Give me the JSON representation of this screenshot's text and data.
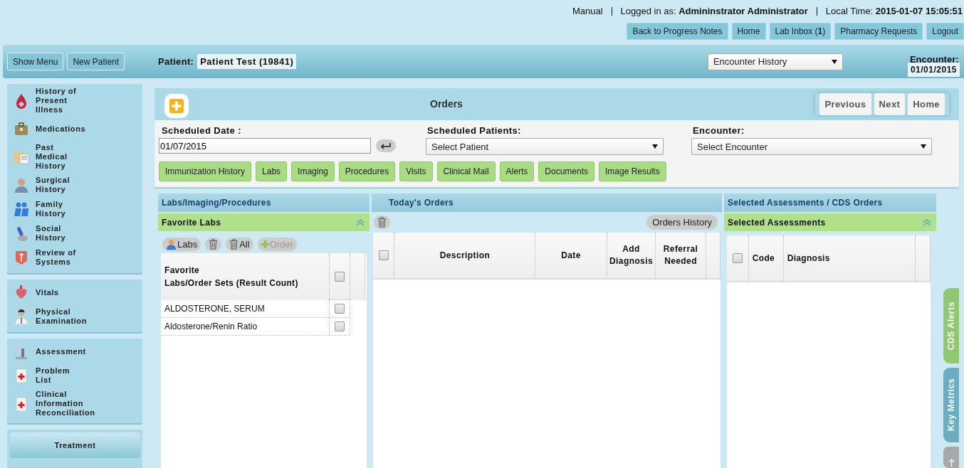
{
  "top": {
    "mode": "Manual",
    "logged_in_label": "Logged in as:",
    "user": "Admininstrator Administrator",
    "time_label": "Local Time:",
    "time": "2015-01-07 15:05:51"
  },
  "top_buttons": [
    "Back to Progress Notes",
    "Home",
    "Lab Inbox (**1**)",
    "Pharmacy Requests",
    "Logout"
  ],
  "toolbar": {
    "buttons": [
      "Show Menu",
      "New Patient"
    ],
    "patient_label": "Patient:",
    "patient": "Patient Test (19841)",
    "history_select": "Encounter History",
    "encounter_label": "Encounter:",
    "encounter": "01/01/2015"
  },
  "sidebar": {
    "groups": [
      {
        "items": [
          "History of\nPresent\nIllness",
          "Medications",
          "Past\nMedical\nHistory",
          "Surgical\nHistory",
          "Family\nHistory",
          "Social\nHistory",
          "Review of\nSystems"
        ]
      },
      {
        "items": [
          "Vitals",
          "Physical\nExamination"
        ]
      },
      {
        "items": [
          "Assessment",
          "Problem\nList",
          "Clinical\nInformation\nReconciliation"
        ]
      }
    ],
    "treatment": "Treatment"
  },
  "orders": {
    "title": "Orders",
    "nav": [
      "Previous",
      "Next",
      "Home"
    ],
    "fields": [
      {
        "label": "Scheduled Date :",
        "value": "01/07/2015",
        "kind": "date"
      },
      {
        "label": "Scheduled Patients:",
        "value": "Select Patient",
        "kind": "select"
      },
      {
        "label": "Encounter:",
        "value": "Select Encounter",
        "kind": "select"
      }
    ],
    "categories": [
      "Immunization History",
      "Labs",
      "Imaging",
      "Procedures",
      "Visits",
      "Clinical Mail",
      "Alerts",
      "Documents",
      "Image Results"
    ]
  },
  "labs_panel": {
    "title": "Labs/Imaging/Procedures",
    "section": "Favorite Labs",
    "tools": [
      {
        "kind": "labs",
        "label": "Labs",
        "disabled": false
      },
      {
        "kind": "delete",
        "disabled": false
      },
      {
        "kind": "delete-all",
        "label": "All",
        "disabled": false
      },
      {
        "kind": "order",
        "label": "Order",
        "disabled": true
      }
    ],
    "header": "Favorite\nLabs/Order Sets (Result Count)",
    "header_checked": false,
    "rows": [
      {
        "name": "ALDOSTERONE, SERUM",
        "checked": false
      },
      {
        "name": "Aldosterone/Renin Ratio",
        "checked": false
      }
    ]
  },
  "orders_panel": {
    "title": "Today's Orders",
    "history_button": "Orders History",
    "header_checked": false,
    "columns": [
      "Description",
      "Date",
      "Add\nDiagnosis",
      "Referral\nNeeded"
    ]
  },
  "assess_panel": {
    "title": "Selected Assessments / CDS Orders",
    "section": "Selected Assessments",
    "header_checked": false,
    "columns": [
      "Code",
      "Diagnosis"
    ]
  },
  "side_tabs": [
    {
      "label": "CDS Alerts",
      "color": "#8fc86e"
    },
    {
      "label": "Key Metrics",
      "color": "#6aaebf"
    }
  ]
}
